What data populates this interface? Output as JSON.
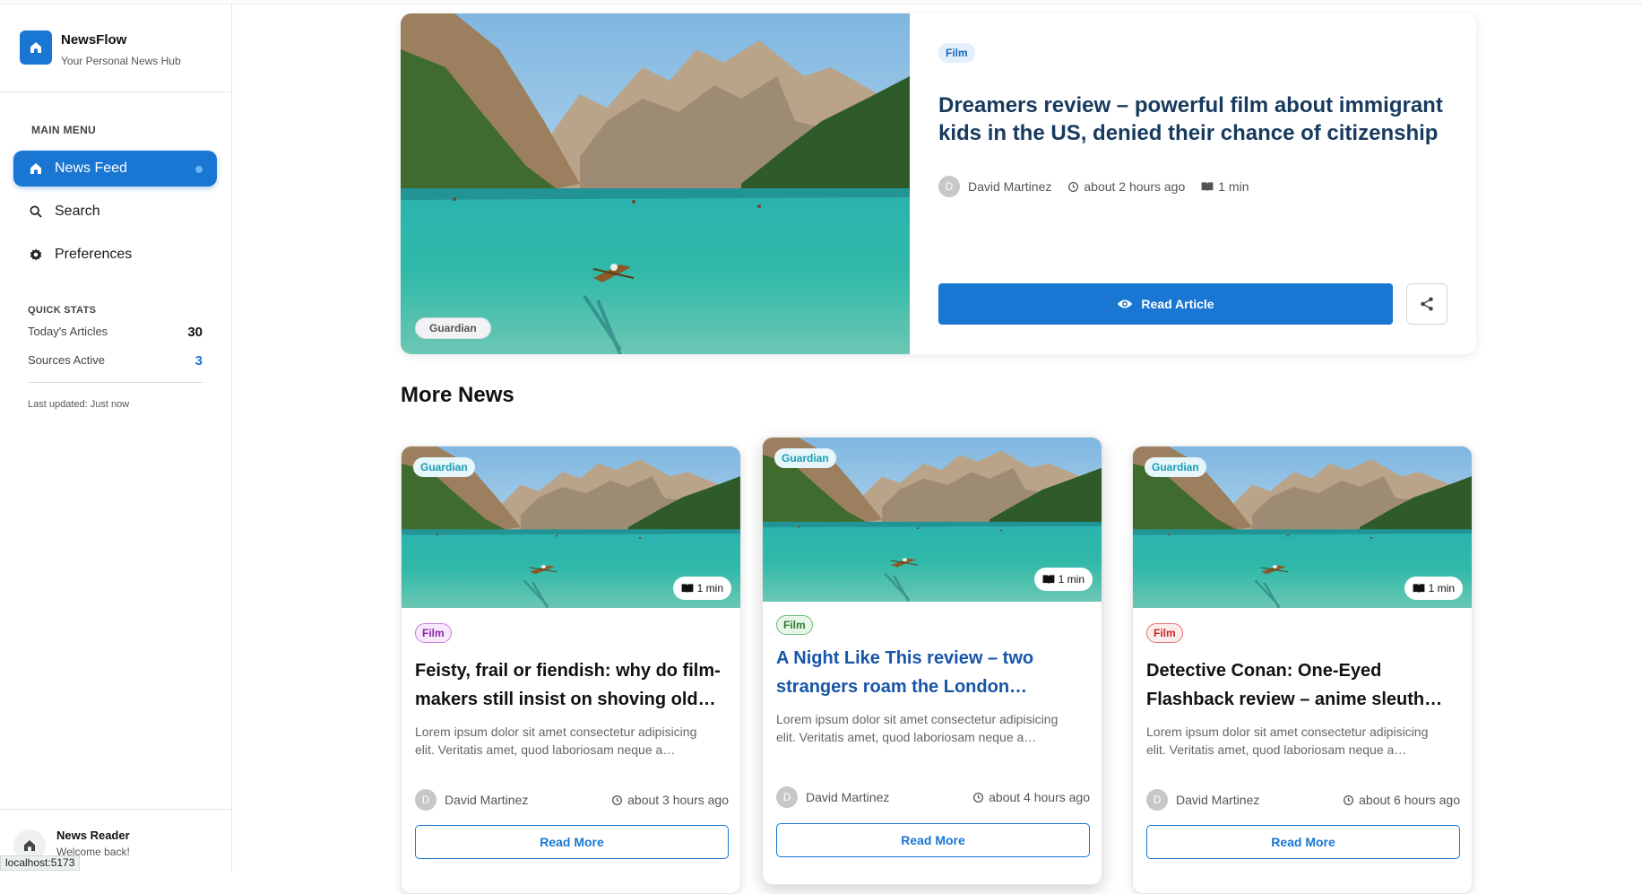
{
  "app": {
    "name": "NewsFlow",
    "tagline": "Your Personal News Hub"
  },
  "sidebar": {
    "menu_title": "MAIN MENU",
    "items": [
      {
        "label": "News Feed",
        "icon": "home-icon",
        "active": true
      },
      {
        "label": "Search",
        "icon": "search-icon",
        "active": false
      },
      {
        "label": "Preferences",
        "icon": "gear-icon",
        "active": false
      }
    ],
    "stats_title": "QUICK STATS",
    "stats": [
      {
        "label": "Today's Articles",
        "value": "30"
      },
      {
        "label": "Sources Active",
        "value": "3"
      }
    ],
    "last_updated": "Last updated: Just now",
    "user": {
      "name": "News Reader",
      "subtitle": "Welcome back!"
    }
  },
  "status_bar": {
    "url": "localhost:5173"
  },
  "hero": {
    "source": "Guardian",
    "category": "Film",
    "title": "Dreamers review – powerful film about immigrant kids in the US, denied their chance of citizenship",
    "author_initial": "D",
    "author": "David Martinez",
    "time": "about 2 hours ago",
    "read_time": "1 min",
    "read_button": "Read Article"
  },
  "more_news": {
    "title": "More News",
    "cards": [
      {
        "source": "Guardian",
        "read_time": "1 min",
        "category": "Film",
        "category_color": "#8e24aa",
        "category_bg": "#f6e8fa",
        "title": "Feisty, frail or fiendish: why do film-makers still insist on shoving old…",
        "title_color": "#111111",
        "excerpt": "Lorem ipsum dolor sit amet consectetur adipisicing elit. Veritatis amet, quod laboriosam neque a…",
        "author_initial": "D",
        "author": "David Martinez",
        "time": "about 3 hours ago",
        "button": "Read More"
      },
      {
        "source": "Guardian",
        "read_time": "1 min",
        "category": "Film",
        "category_color": "#2e7d32",
        "category_bg": "#e8f5e9",
        "title": "A Night Like This review – two strangers roam the London…",
        "title_color": "#1655a8",
        "excerpt": "Lorem ipsum dolor sit amet consectetur adipisicing elit. Veritatis amet, quod laboriosam neque a…",
        "author_initial": "D",
        "author": "David Martinez",
        "time": "about 4 hours ago",
        "button": "Read More"
      },
      {
        "source": "Guardian",
        "read_time": "1 min",
        "category": "Film",
        "category_color": "#c62828",
        "category_bg": "#fdecec",
        "title": "Detective Conan: One-Eyed Flashback review – anime sleuth…",
        "title_color": "#111111",
        "excerpt": "Lorem ipsum dolor sit amet consectetur adipisicing elit. Veritatis amet, quod laboriosam neque a…",
        "author_initial": "D",
        "author": "David Martinez",
        "time": "about 6 hours ago",
        "button": "Read More"
      }
    ]
  }
}
